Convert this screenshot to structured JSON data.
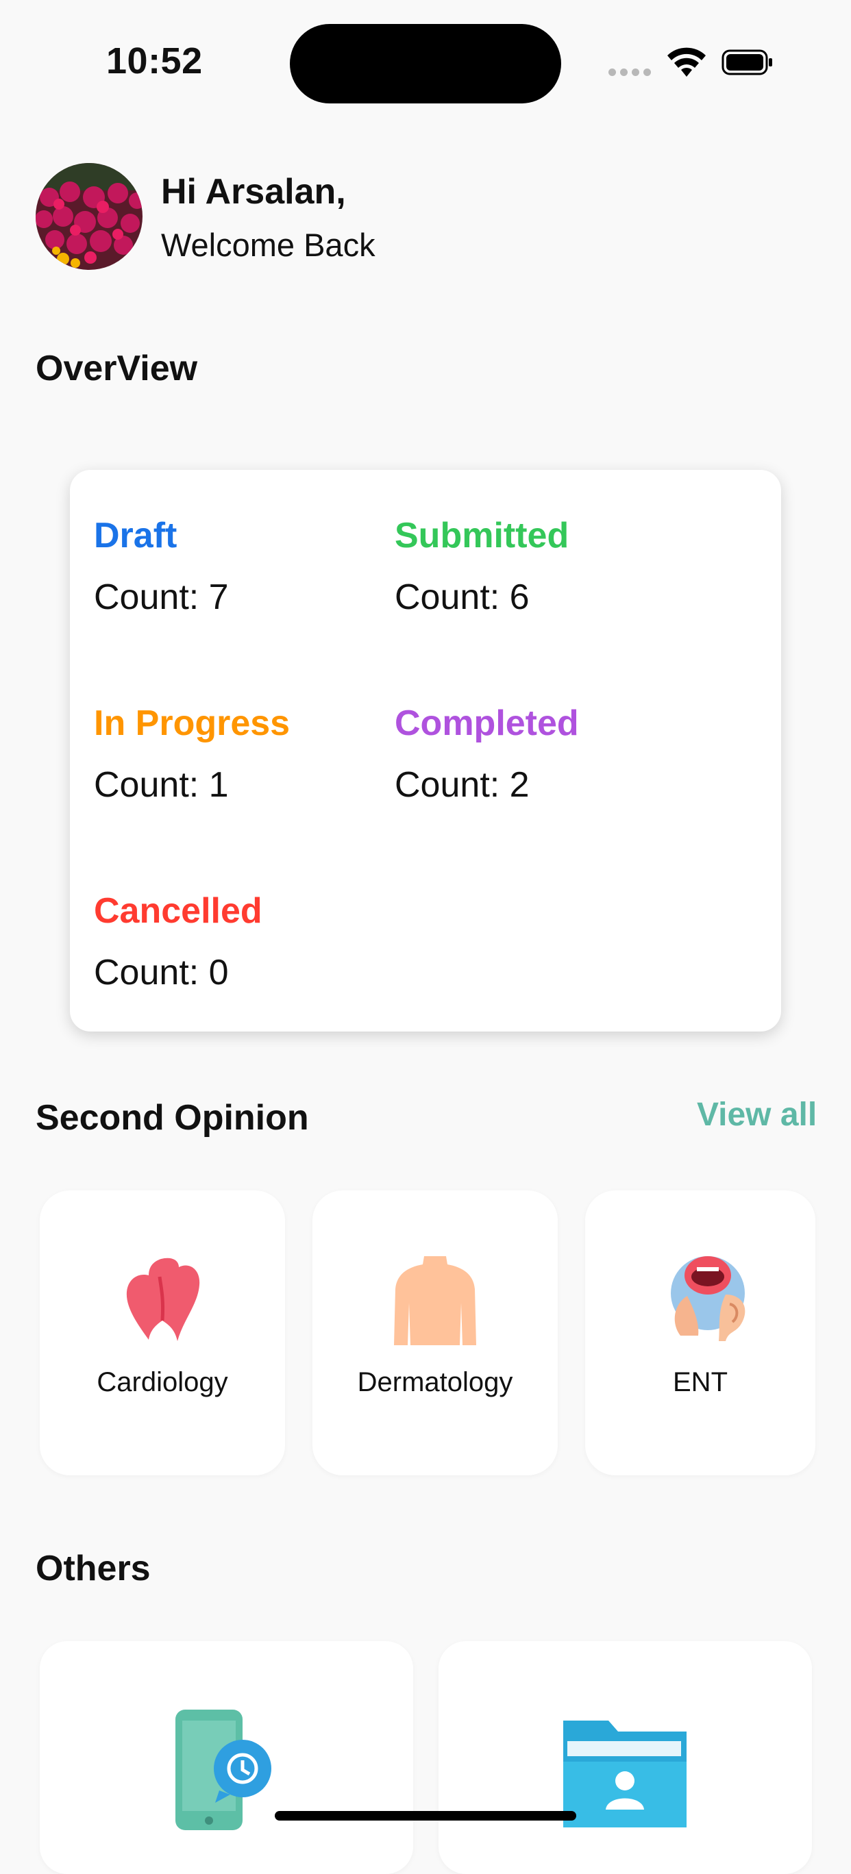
{
  "status_bar": {
    "time": "10:52"
  },
  "header": {
    "greeting": "Hi Arsalan,",
    "subtitle": "Welcome Back"
  },
  "overview": {
    "title": "OverView",
    "stats": [
      {
        "label": "Draft",
        "count": "Count: 7",
        "color": "#1a73e8"
      },
      {
        "label": "Submitted",
        "count": "Count: 6",
        "color": "#34c759"
      },
      {
        "label": "In Progress",
        "count": "Count: 1",
        "color": "#ff9500"
      },
      {
        "label": "Completed",
        "count": "Count: 2",
        "color": "#af52de"
      },
      {
        "label": "Cancelled",
        "count": "Count: 0",
        "color": "#ff3b30"
      }
    ]
  },
  "second_opinion": {
    "title": "Second Opinion",
    "view_all": "View all",
    "specialties": [
      {
        "label": "Cardiology",
        "icon": "heart-icon"
      },
      {
        "label": "Dermatology",
        "icon": "torso-icon"
      },
      {
        "label": "ENT",
        "icon": "ent-icon"
      }
    ]
  },
  "others": {
    "title": "Others",
    "items": [
      {
        "icon": "phone-history-icon"
      },
      {
        "icon": "patient-folder-icon"
      }
    ]
  },
  "colors": {
    "accent": "#5fb8a6",
    "background": "#f9f9f9"
  }
}
